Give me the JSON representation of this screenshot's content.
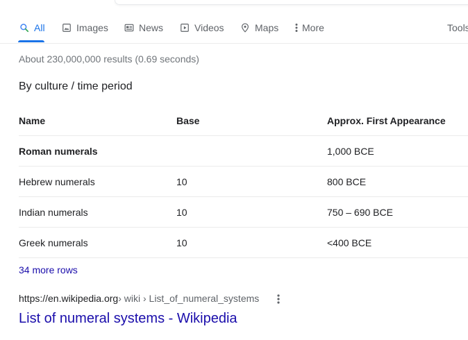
{
  "tabs": [
    {
      "label": "All",
      "icon": "search-icon",
      "active": true
    },
    {
      "label": "Images",
      "icon": "image-icon"
    },
    {
      "label": "News",
      "icon": "news-icon"
    },
    {
      "label": "Videos",
      "icon": "video-icon"
    },
    {
      "label": "Maps",
      "icon": "map-pin-icon"
    },
    {
      "label": "More",
      "icon": "more-vert-icon"
    }
  ],
  "tools_label": "Tools",
  "stats": "About 230,000,000 results (0.69 seconds)",
  "section_title": "By culture / time period",
  "table": {
    "headers": [
      "Name",
      "Base",
      "Approx. First Appearance"
    ],
    "rows": [
      [
        "Roman numerals",
        "",
        "1,000 BCE"
      ],
      [
        "Hebrew numerals",
        "10",
        "800 BCE"
      ],
      [
        "Indian numerals",
        "10",
        "750 – 690 BCE"
      ],
      [
        "Greek numerals",
        "10",
        "<400 BCE"
      ]
    ]
  },
  "more_rows": "34 more rows",
  "result": {
    "url_base": "https://en.wikipedia.org",
    "breadcrumb": " › wiki › List_of_numeral_systems",
    "title": "List of numeral systems - Wikipedia"
  },
  "colors": {
    "accent": "#1a73e8",
    "link": "#1a0dab",
    "muted": "#70757a"
  }
}
